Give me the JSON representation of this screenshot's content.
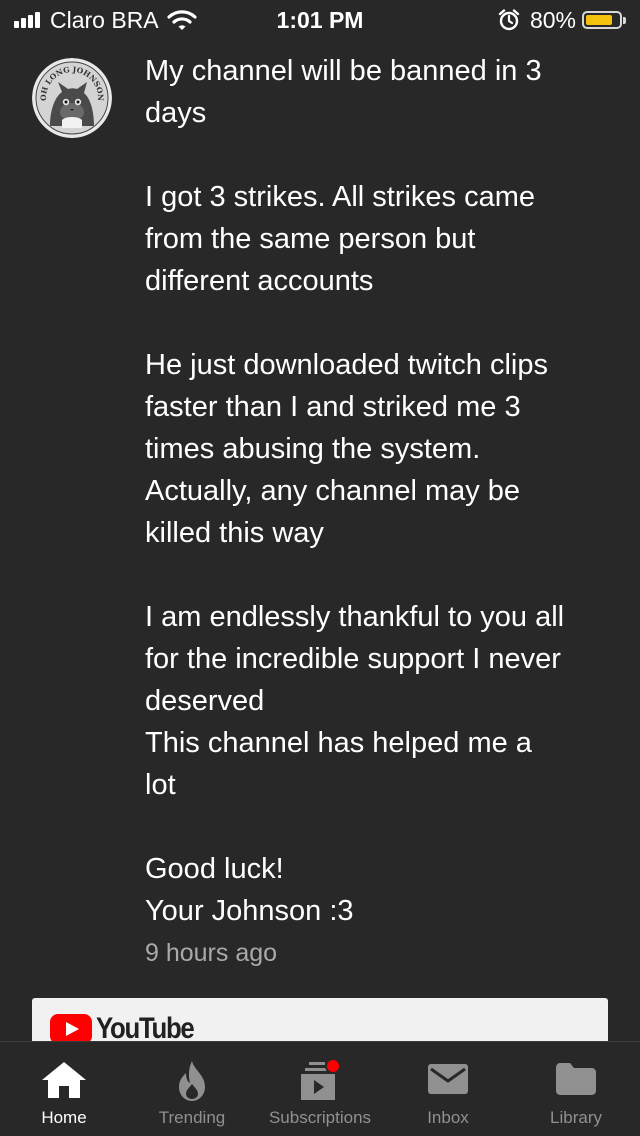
{
  "status_bar": {
    "carrier": "Claro BRA",
    "time": "1:01 PM",
    "battery_percent": "80%",
    "battery_level": 0.8,
    "signal_bars": 4,
    "icons": [
      "signal-icon",
      "wifi-icon",
      "alarm-icon",
      "battery-icon"
    ]
  },
  "post": {
    "avatar_text": "OH LONG JOHNSON",
    "text": "My channel will be banned in 3\ndays\n\nI got 3 strikes. All strikes came\nfrom the same person but\ndifferent accounts\n\nHe just downloaded twitch clips\nfaster than I and striked me 3\ntimes abusing the system.\nActually, any channel may be\nkilled this way\n\nI am endlessly thankful to you all\nfor the incredible support I never\ndeserved\nThis channel has helped me a\nlot\n\nGood luck!\nYour Johnson :3",
    "timestamp": "9 hours ago"
  },
  "embed": {
    "logo_text": "YouTube"
  },
  "bottom_nav": {
    "items": [
      {
        "label": "Home",
        "icon": "home-icon",
        "active": true
      },
      {
        "label": "Trending",
        "icon": "flame-icon",
        "active": false
      },
      {
        "label": "Subscriptions",
        "icon": "subscriptions-icon",
        "active": false,
        "badge": true
      },
      {
        "label": "Inbox",
        "icon": "mail-icon",
        "active": false
      },
      {
        "label": "Library",
        "icon": "folder-icon",
        "active": false
      }
    ]
  },
  "colors": {
    "background": "#282828",
    "text_primary": "#ffffff",
    "text_secondary": "#a9a9a9",
    "nav_inactive": "#909090",
    "battery": "#f4c20d",
    "youtube_red": "#ff0000",
    "notification_dot": "#ff0000"
  }
}
